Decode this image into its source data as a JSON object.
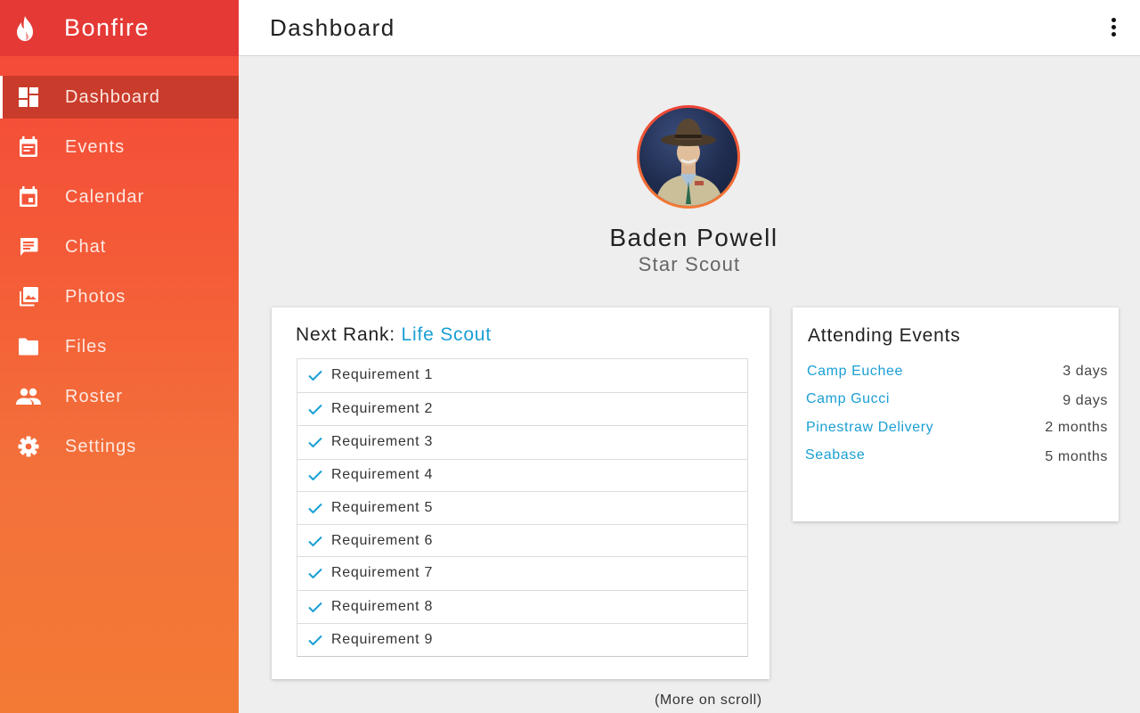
{
  "app": {
    "name": "Bonfire",
    "brand_colors": {
      "header": "#e53935",
      "gradient_top": "#f4473a",
      "gradient_bottom": "#f37a35",
      "accent": "#1a9fd4"
    }
  },
  "sidebar": {
    "items": [
      {
        "label": "Dashboard",
        "icon": "dashboard-icon",
        "active": true
      },
      {
        "label": "Events",
        "icon": "event-note-icon",
        "active": false
      },
      {
        "label": "Calendar",
        "icon": "calendar-icon",
        "active": false
      },
      {
        "label": "Chat",
        "icon": "chat-icon",
        "active": false
      },
      {
        "label": "Photos",
        "icon": "photo-library-icon",
        "active": false
      },
      {
        "label": "Files",
        "icon": "folder-icon",
        "active": false
      },
      {
        "label": "Roster",
        "icon": "people-icon",
        "active": false
      },
      {
        "label": "Settings",
        "icon": "gear-icon",
        "active": false
      }
    ]
  },
  "header": {
    "title": "Dashboard",
    "menu_icon": "more-vert-icon"
  },
  "profile": {
    "name": "Baden Powell",
    "rank": "Star Scout"
  },
  "next_rank": {
    "label": "Next Rank:",
    "rank": "Life Scout",
    "requirements": [
      {
        "label": "Requirement 1",
        "done": true
      },
      {
        "label": "Requirement 2",
        "done": true
      },
      {
        "label": "Requirement 3",
        "done": true
      },
      {
        "label": "Requirement 4",
        "done": true
      },
      {
        "label": "Requirement 5",
        "done": true
      },
      {
        "label": "Requirement 6",
        "done": true
      },
      {
        "label": "Requirement 7",
        "done": true
      },
      {
        "label": "Requirement 8",
        "done": true
      },
      {
        "label": "Requirement 9",
        "done": true
      }
    ]
  },
  "attending_events": {
    "title": "Attending Events",
    "events": [
      {
        "name": "Camp Euchee",
        "time": "3 days"
      },
      {
        "name": "Camp Gucci",
        "time": "9 days"
      },
      {
        "name": "Pinestraw Delivery",
        "time": "2 months"
      },
      {
        "name": "Seabase",
        "time": "5 months"
      }
    ]
  },
  "footer_note": "(More on scroll)"
}
